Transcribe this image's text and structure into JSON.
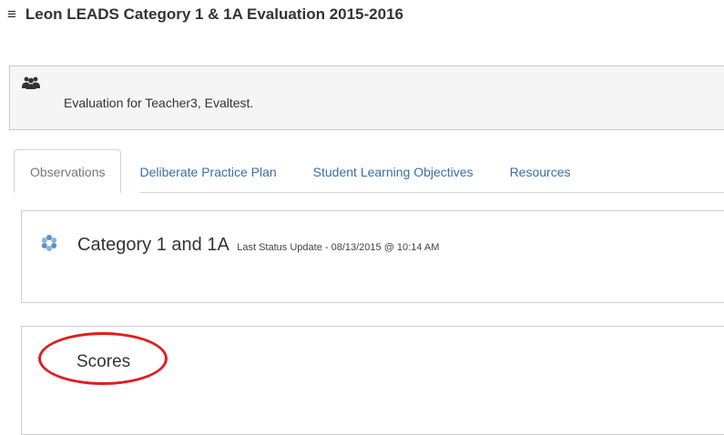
{
  "header": {
    "menu_icon": "hamburger-menu-icon",
    "title": "Leon LEADS Category 1 & 1A Evaluation 2015-2016"
  },
  "evaluation": {
    "icon": "users-icon",
    "text": "Evaluation for Teacher3, Evaltest."
  },
  "tabs": [
    {
      "label": "Observations",
      "active": true
    },
    {
      "label": "Deliberate Practice Plan",
      "active": false
    },
    {
      "label": "Student Learning Objectives",
      "active": false
    },
    {
      "label": "Resources",
      "active": false
    }
  ],
  "category": {
    "icon": "status-pinwheel-icon",
    "title": "Category 1 and 1A",
    "status_update": "Last Status Update - 08/13/2015 @ 10:14 AM"
  },
  "scores": {
    "label": "Scores",
    "annotation_color": "#e21d1d"
  },
  "colors": {
    "link": "#3b6ea8",
    "panel_bg": "#f5f5f5",
    "annotation": "#e21d1d"
  }
}
